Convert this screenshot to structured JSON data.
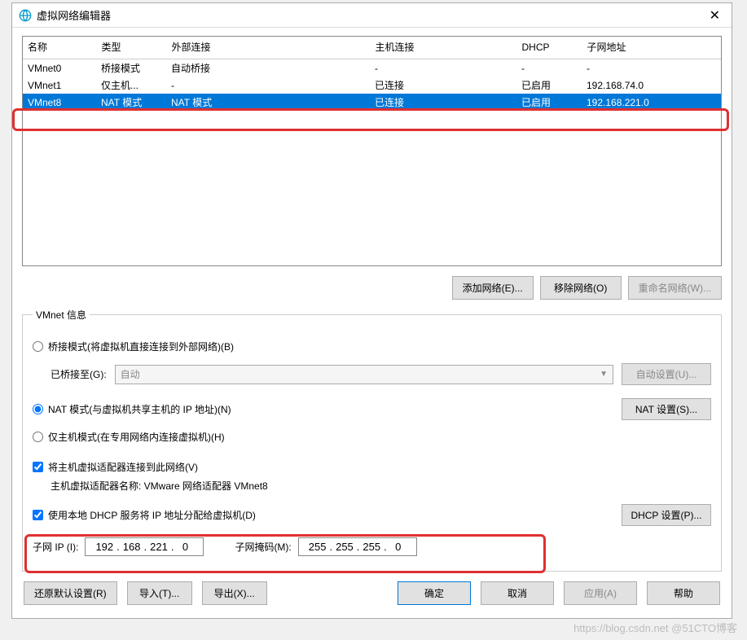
{
  "window": {
    "title": "虚拟网络编辑器"
  },
  "table": {
    "headers": [
      "名称",
      "类型",
      "外部连接",
      "主机连接",
      "DHCP",
      "子网地址"
    ],
    "rows": [
      {
        "name": "VMnet0",
        "type": "桥接模式",
        "ext": "自动桥接",
        "host": "-",
        "dhcp": "-",
        "subnet": "-"
      },
      {
        "name": "VMnet1",
        "type": "仅主机...",
        "ext": "-",
        "host": "已连接",
        "dhcp": "已启用",
        "subnet": "192.168.74.0"
      },
      {
        "name": "VMnet8",
        "type": "NAT 模式",
        "ext": "NAT 模式",
        "host": "已连接",
        "dhcp": "已启用",
        "subnet": "192.168.221.0",
        "selected": true
      }
    ]
  },
  "table_buttons": {
    "add": "添加网络(E)...",
    "remove": "移除网络(O)",
    "rename": "重命名网络(W)..."
  },
  "fieldset": {
    "legend": "VMnet 信息",
    "bridge_radio": "桥接模式(将虚拟机直接连接到外部网络)(B)",
    "bridge_to_label": "已桥接至(G):",
    "bridge_combo": "自动",
    "auto_settings_btn": "自动设置(U)...",
    "nat_radio": "NAT 模式(与虚拟机共享主机的 IP 地址)(N)",
    "nat_settings_btn": "NAT 设置(S)...",
    "hostonly_radio": "仅主机模式(在专用网络内连接虚拟机)(H)",
    "connect_host_check": "将主机虚拟适配器连接到此网络(V)",
    "adapter_name_label": "主机虚拟适配器名称: VMware 网络适配器 VMnet8",
    "dhcp_check": "使用本地 DHCP 服务将 IP 地址分配给虚拟机(D)",
    "dhcp_settings_btn": "DHCP 设置(P)...",
    "subnet_ip_label": "子网 IP (I):",
    "subnet_ip": [
      "192",
      "168",
      "221",
      "0"
    ],
    "subnet_mask_label": "子网掩码(M):",
    "subnet_mask": [
      "255",
      "255",
      "255",
      "0"
    ]
  },
  "bottom": {
    "restore": "还原默认设置(R)",
    "import": "导入(T)...",
    "export": "导出(X)...",
    "ok": "确定",
    "cancel": "取消",
    "apply": "应用(A)",
    "help": "帮助"
  },
  "watermark": "https://blog.csdn.net @51CTO博客"
}
